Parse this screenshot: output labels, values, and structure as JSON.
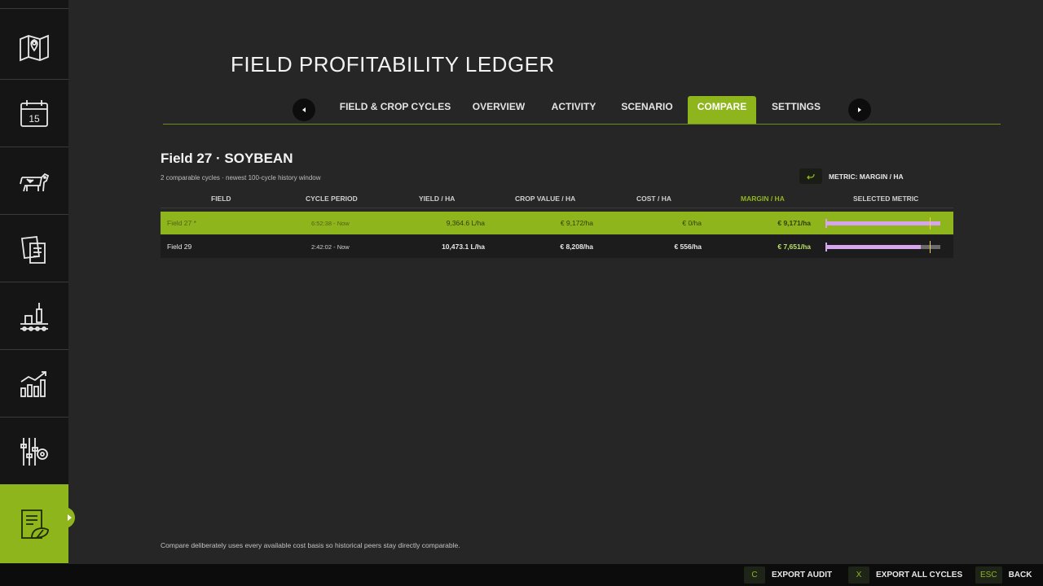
{
  "title": "FIELD PROFITABILITY LEDGER",
  "tabs": [
    {
      "label": "FIELD & CROP CYCLES"
    },
    {
      "label": "OVERVIEW"
    },
    {
      "label": "ACTIVITY"
    },
    {
      "label": "SCENARIO"
    },
    {
      "label": "COMPARE"
    },
    {
      "label": "SETTINGS"
    }
  ],
  "active_tab": "COMPARE",
  "sidebar": {
    "items": [
      {
        "icon": "map-pin-icon"
      },
      {
        "icon": "calendar-icon",
        "text": "15"
      },
      {
        "icon": "cow-icon"
      },
      {
        "icon": "contracts-icon"
      },
      {
        "icon": "production-icon"
      },
      {
        "icon": "statistics-icon"
      },
      {
        "icon": "settings-sliders-icon"
      },
      {
        "icon": "field-ledger-icon"
      }
    ],
    "active_index": 7
  },
  "section": {
    "title": "Field 27  ·  SOYBEAN",
    "subtitle": "2 comparable cycles · newest 100-cycle history window",
    "metric_label": "METRIC: MARGIN / HA"
  },
  "table": {
    "headers": [
      "FIELD",
      "CYCLE PERIOD",
      "YIELD / HA",
      "CROP VALUE / HA",
      "COST / HA",
      "MARGIN / HA",
      "SELECTED METRIC"
    ],
    "highlighted_header": "MARGIN / HA",
    "rows": [
      {
        "field": "Field 27  *",
        "period": "6:52:38 - Now",
        "yield": "9,364.6 L/ha",
        "value": "€ 9,172/ha",
        "cost": "€ 0/ha",
        "margin": "€ 9,171/ha",
        "metric_fraction": 1.0,
        "marker_fraction": 0.91,
        "selected": true
      },
      {
        "field": "Field 29",
        "period": "2:42:02 - Now",
        "yield": "10,473.1 L/ha",
        "value": "€ 8,208/ha",
        "cost": "€ 556/ha",
        "margin": "€ 7,651/ha",
        "metric_fraction": 0.83,
        "marker_fraction": 0.91,
        "selected": false
      }
    ]
  },
  "footnote": "Compare deliberately uses every available cost basis so historical peers stay directly comparable.",
  "actions": [
    {
      "key": "C",
      "label": "EXPORT AUDIT"
    },
    {
      "key": "X",
      "label": "EXPORT ALL CYCLES"
    },
    {
      "key": "ESC",
      "label": "BACK"
    }
  ],
  "colors": {
    "accent": "#8fb51d",
    "bar": "#d7a5ee",
    "background": "#262626",
    "sidebar": "#151515"
  }
}
